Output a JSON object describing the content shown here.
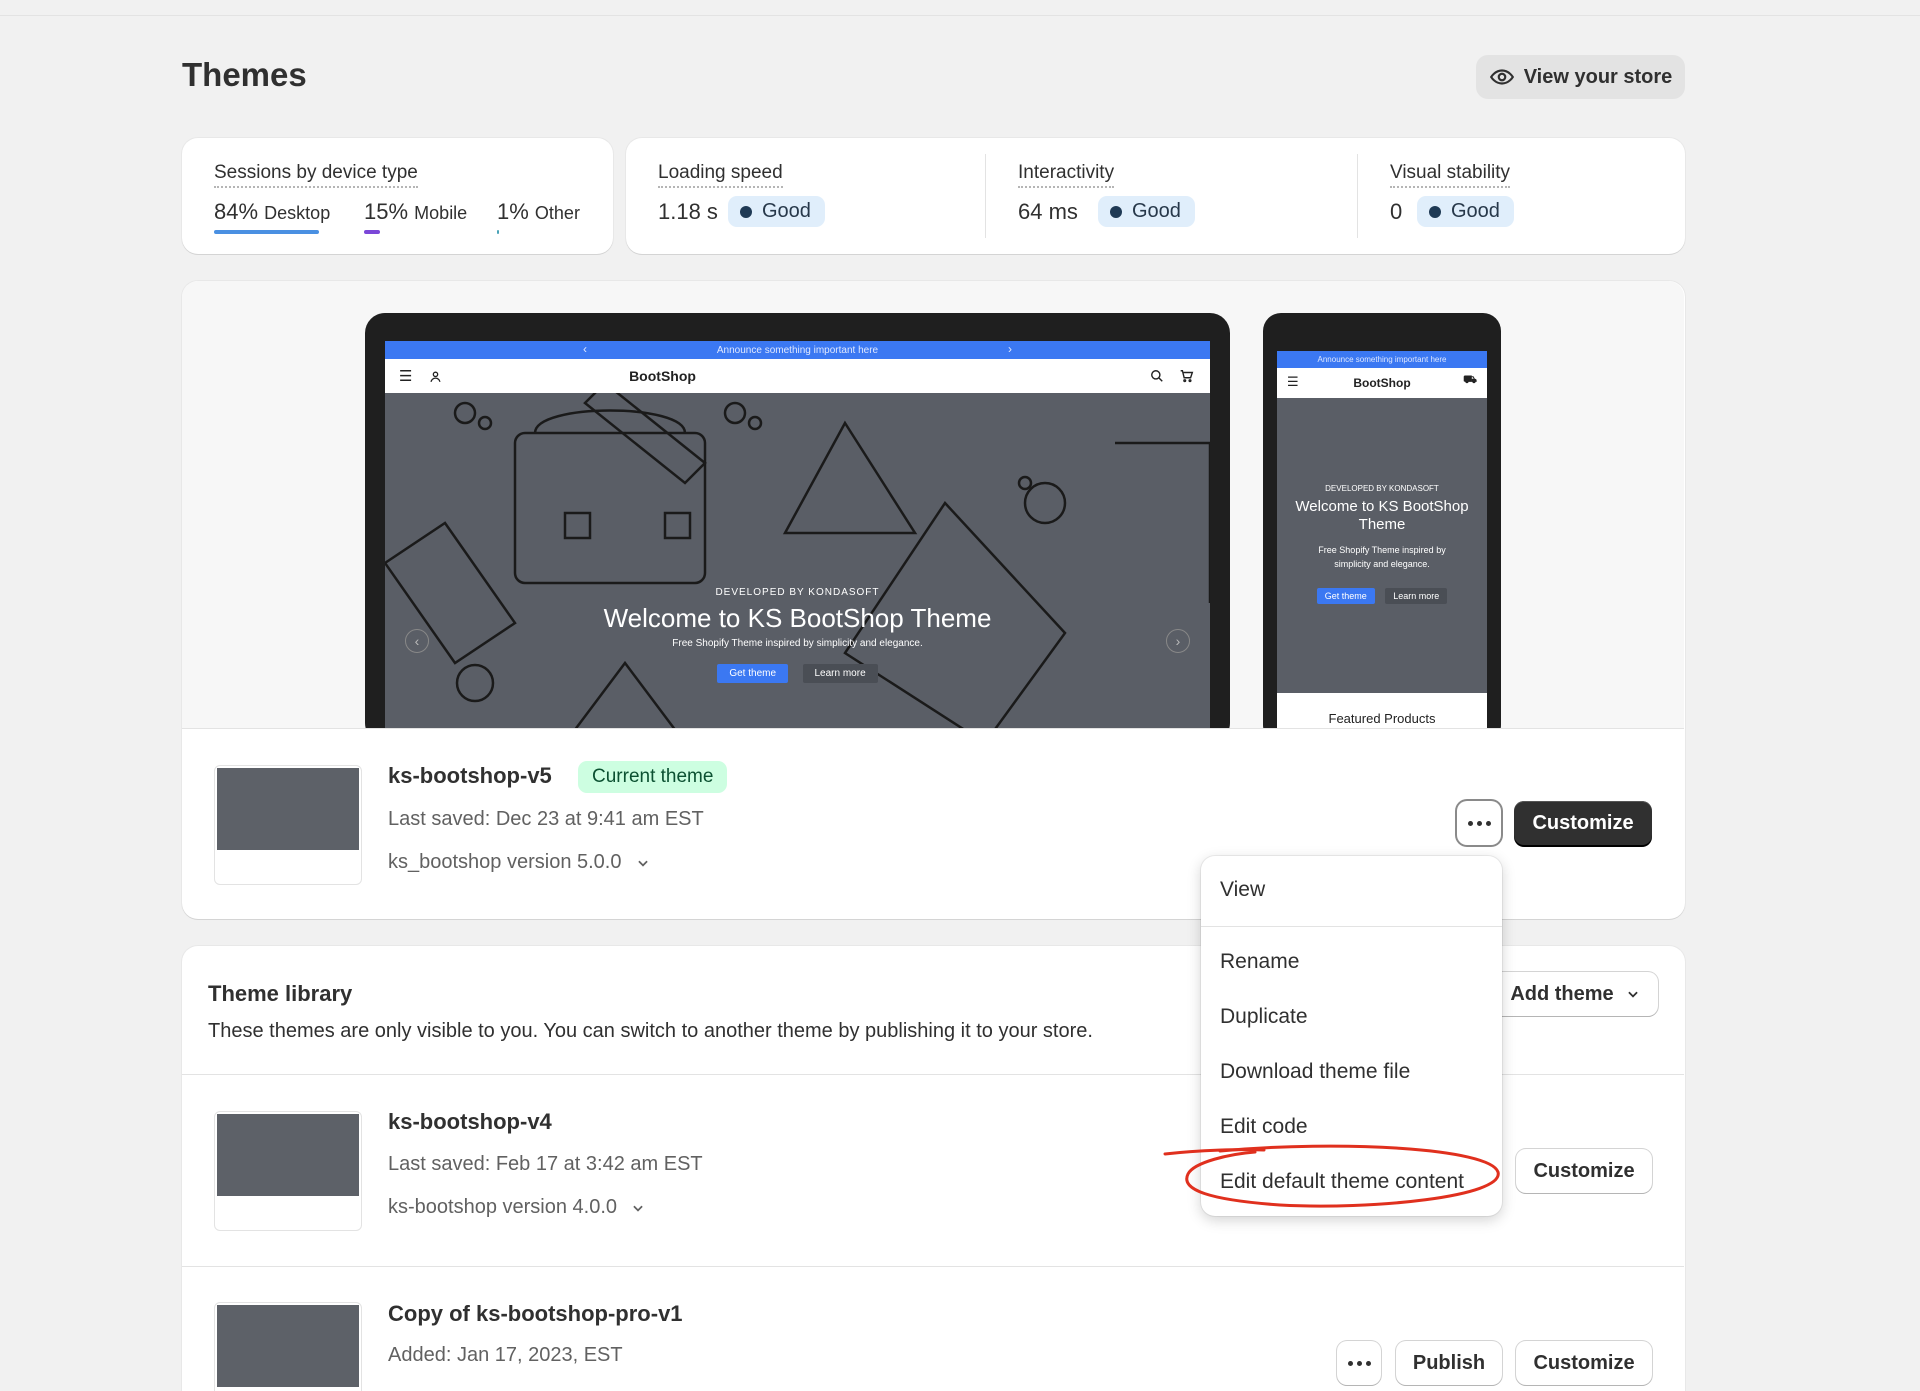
{
  "page": {
    "title": "Themes"
  },
  "header": {
    "view_store_label": "View your store"
  },
  "sessions": {
    "label": "Sessions by device type",
    "items": [
      {
        "percent": "84%",
        "label": "Desktop",
        "color": "#4a90e2"
      },
      {
        "percent": "15%",
        "label": "Mobile",
        "color": "#7b47d8"
      },
      {
        "percent": "1%",
        "label": "Other",
        "color": "#4aa3b8"
      }
    ]
  },
  "metrics": [
    {
      "label": "Loading speed",
      "value": "1.18 s",
      "status": "Good"
    },
    {
      "label": "Interactivity",
      "value": "64 ms",
      "status": "Good"
    },
    {
      "label": "Visual stability",
      "value": "0",
      "status": "Good"
    }
  ],
  "preview": {
    "announcement": "Announce something important here",
    "store_name": "BootShop",
    "hero_kicker": "DEVELOPED BY KONDASOFT",
    "hero_title": "Welcome to KS BootShop Theme",
    "hero_subtitle": "Free Shopify Theme inspired by simplicity and elegance.",
    "hero_primary_btn": "Get theme",
    "hero_secondary_btn": "Learn more",
    "phone_kicker": "DEVELOPED BY KONDASOFT",
    "phone_title": "Welcome to KS BootShop Theme",
    "phone_subtitle": "Free Shopify Theme inspired by simplicity and elegance.",
    "featured_label": "Featured Products"
  },
  "current_theme": {
    "name": "ks-bootshop-v5",
    "badge": "Current theme",
    "last_saved": "Last saved: Dec 23 at 9:41 am EST",
    "version": "ks_bootshop version 5.0.0",
    "customize_label": "Customize"
  },
  "library": {
    "title": "Theme library",
    "description": "These themes are only visible to you. You can switch to another theme by publishing it to your store.",
    "add_theme_label": "Add theme",
    "themes": [
      {
        "name": "ks-bootshop-v4",
        "meta": "Last saved: Feb 17 at 3:42 am EST",
        "version": "ks-bootshop version 4.0.0",
        "customize_label": "Customize"
      },
      {
        "name": "Copy of ks-bootshop-pro-v1",
        "meta": "Added: Jan 17, 2023, EST",
        "publish_label": "Publish",
        "customize_label": "Customize"
      }
    ]
  },
  "menu": {
    "items": [
      "View",
      "Rename",
      "Duplicate",
      "Download theme file",
      "Edit code",
      "Edit default theme content"
    ],
    "highlight_color": "#e0301e"
  }
}
